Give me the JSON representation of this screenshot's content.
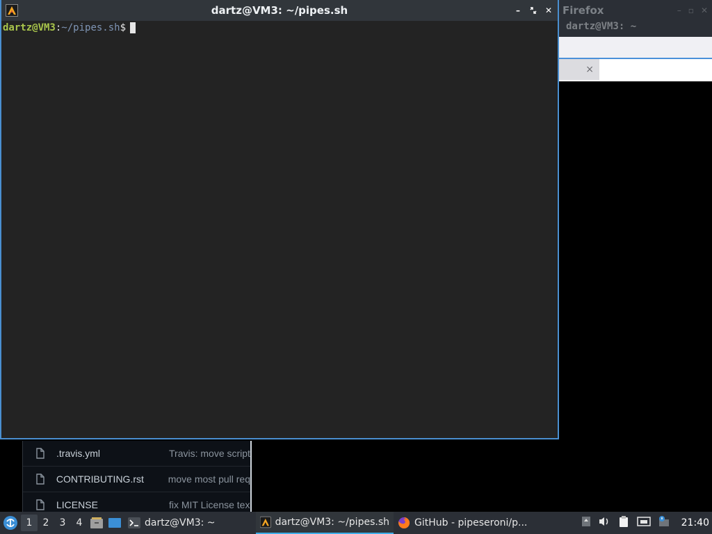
{
  "firefox_bg": {
    "title": "Firefox",
    "terminal_title": "dartz@VM3: ~",
    "tab_close": "×"
  },
  "github_list": {
    "rows": [
      {
        "name": ".travis.yml",
        "message": "Travis: move script"
      },
      {
        "name": "CONTRIBUTING.rst",
        "message": "move most pull req"
      },
      {
        "name": "LICENSE",
        "message": "fix MIT License tex"
      }
    ]
  },
  "terminal": {
    "title": "dartz@VM3: ~/pipes.sh",
    "prompt_user": "dartz@VM3",
    "prompt_sep": ":",
    "prompt_path": "~/pipes.sh",
    "prompt_dollar": "$",
    "controls": {
      "minimize": "–",
      "restore": "▫",
      "close": "✕"
    }
  },
  "taskbar": {
    "workspaces": [
      "1",
      "2",
      "3",
      "4"
    ],
    "active_workspace": "1",
    "tasks": [
      {
        "label": "dartz@VM3: ~",
        "icon": "terminal-icon",
        "active": false
      },
      {
        "label": "dartz@VM3: ~/pipes.sh",
        "icon": "terminal-alacritty-icon",
        "active": true
      },
      {
        "label": "GitHub - pipeseroni/p...",
        "icon": "firefox-icon",
        "active": false
      }
    ],
    "clock": "21:40"
  },
  "colors": {
    "accent": "#3daee9",
    "window_border": "#4a8fd0",
    "prompt_user": "#a9c54b",
    "prompt_path": "#7f95b5",
    "terminal_bg": "#232323",
    "panel_bg": "#2b2f36"
  }
}
